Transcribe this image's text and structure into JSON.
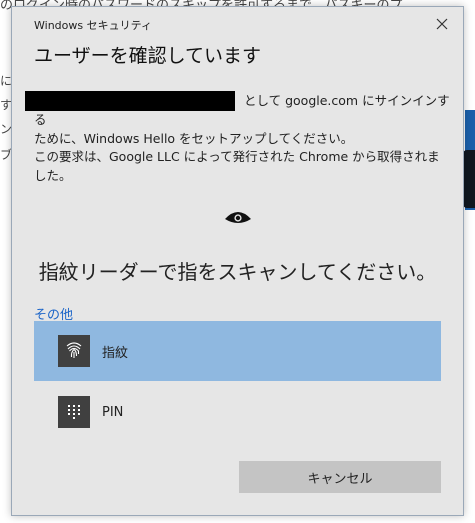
{
  "background": {
    "top_text": "のログイン時のパスワードのスキップを許可するまで、パスキーのプ",
    "side_lines": [
      "に、",
      "する",
      "ン",
      "ブ"
    ]
  },
  "dialog": {
    "title": "Windows セキュリティ",
    "heading": "ユーザーを確認しています",
    "message_line1": "として google.com にサインインする",
    "message_line2": "ために、Windows Hello をセットアップしてください。",
    "message2": "この要求は、Google LLC によって発行された Chrome から取得されました。",
    "prompt": "指紋リーダーで指をスキャンしてください。",
    "other_link": "その他",
    "options": [
      {
        "label": "指紋",
        "icon": "fingerprint-icon",
        "selected": true
      },
      {
        "label": "PIN",
        "icon": "pin-keypad-icon",
        "selected": false
      }
    ],
    "cancel_label": "キャンセル"
  },
  "colors": {
    "dialog_bg": "#e6e6e6",
    "selected_option": "#8fb8e0",
    "link": "#1a64c8",
    "button": "#c4c4c4"
  }
}
